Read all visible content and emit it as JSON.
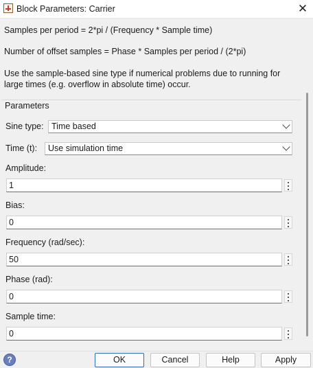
{
  "window": {
    "title": "Block Parameters: Carrier",
    "close_glyph": "✕"
  },
  "description": {
    "line1": "Samples per period = 2*pi / (Frequency * Sample time)",
    "line2": "Number of offset samples = Phase * Samples per period / (2*pi)",
    "line3a": "Use the sample-based sine type if numerical problems due to running for",
    "line3b": "large times (e.g. overflow in absolute time) occur."
  },
  "parameters": {
    "section_label": "Parameters",
    "sine_type": {
      "label": "Sine type:",
      "value": "Time based"
    },
    "time": {
      "label": "Time (t):",
      "value": "Use simulation time"
    },
    "fields": [
      {
        "label": "Amplitude:",
        "value": "1"
      },
      {
        "label": "Bias:",
        "value": "0"
      },
      {
        "label": "Frequency (rad/sec):",
        "value": "50"
      },
      {
        "label": "Phase (rad):",
        "value": "0"
      },
      {
        "label": "Sample time:",
        "value": "0"
      }
    ]
  },
  "footer": {
    "help_icon_glyph": "?",
    "ok_label": "OK",
    "cancel_label": "Cancel",
    "help_label": "Help",
    "apply_label": "Apply"
  },
  "colors": {
    "accent": "#2f6cc0",
    "background": "#f0f0f0",
    "help_icon": "#6b7fbf"
  }
}
